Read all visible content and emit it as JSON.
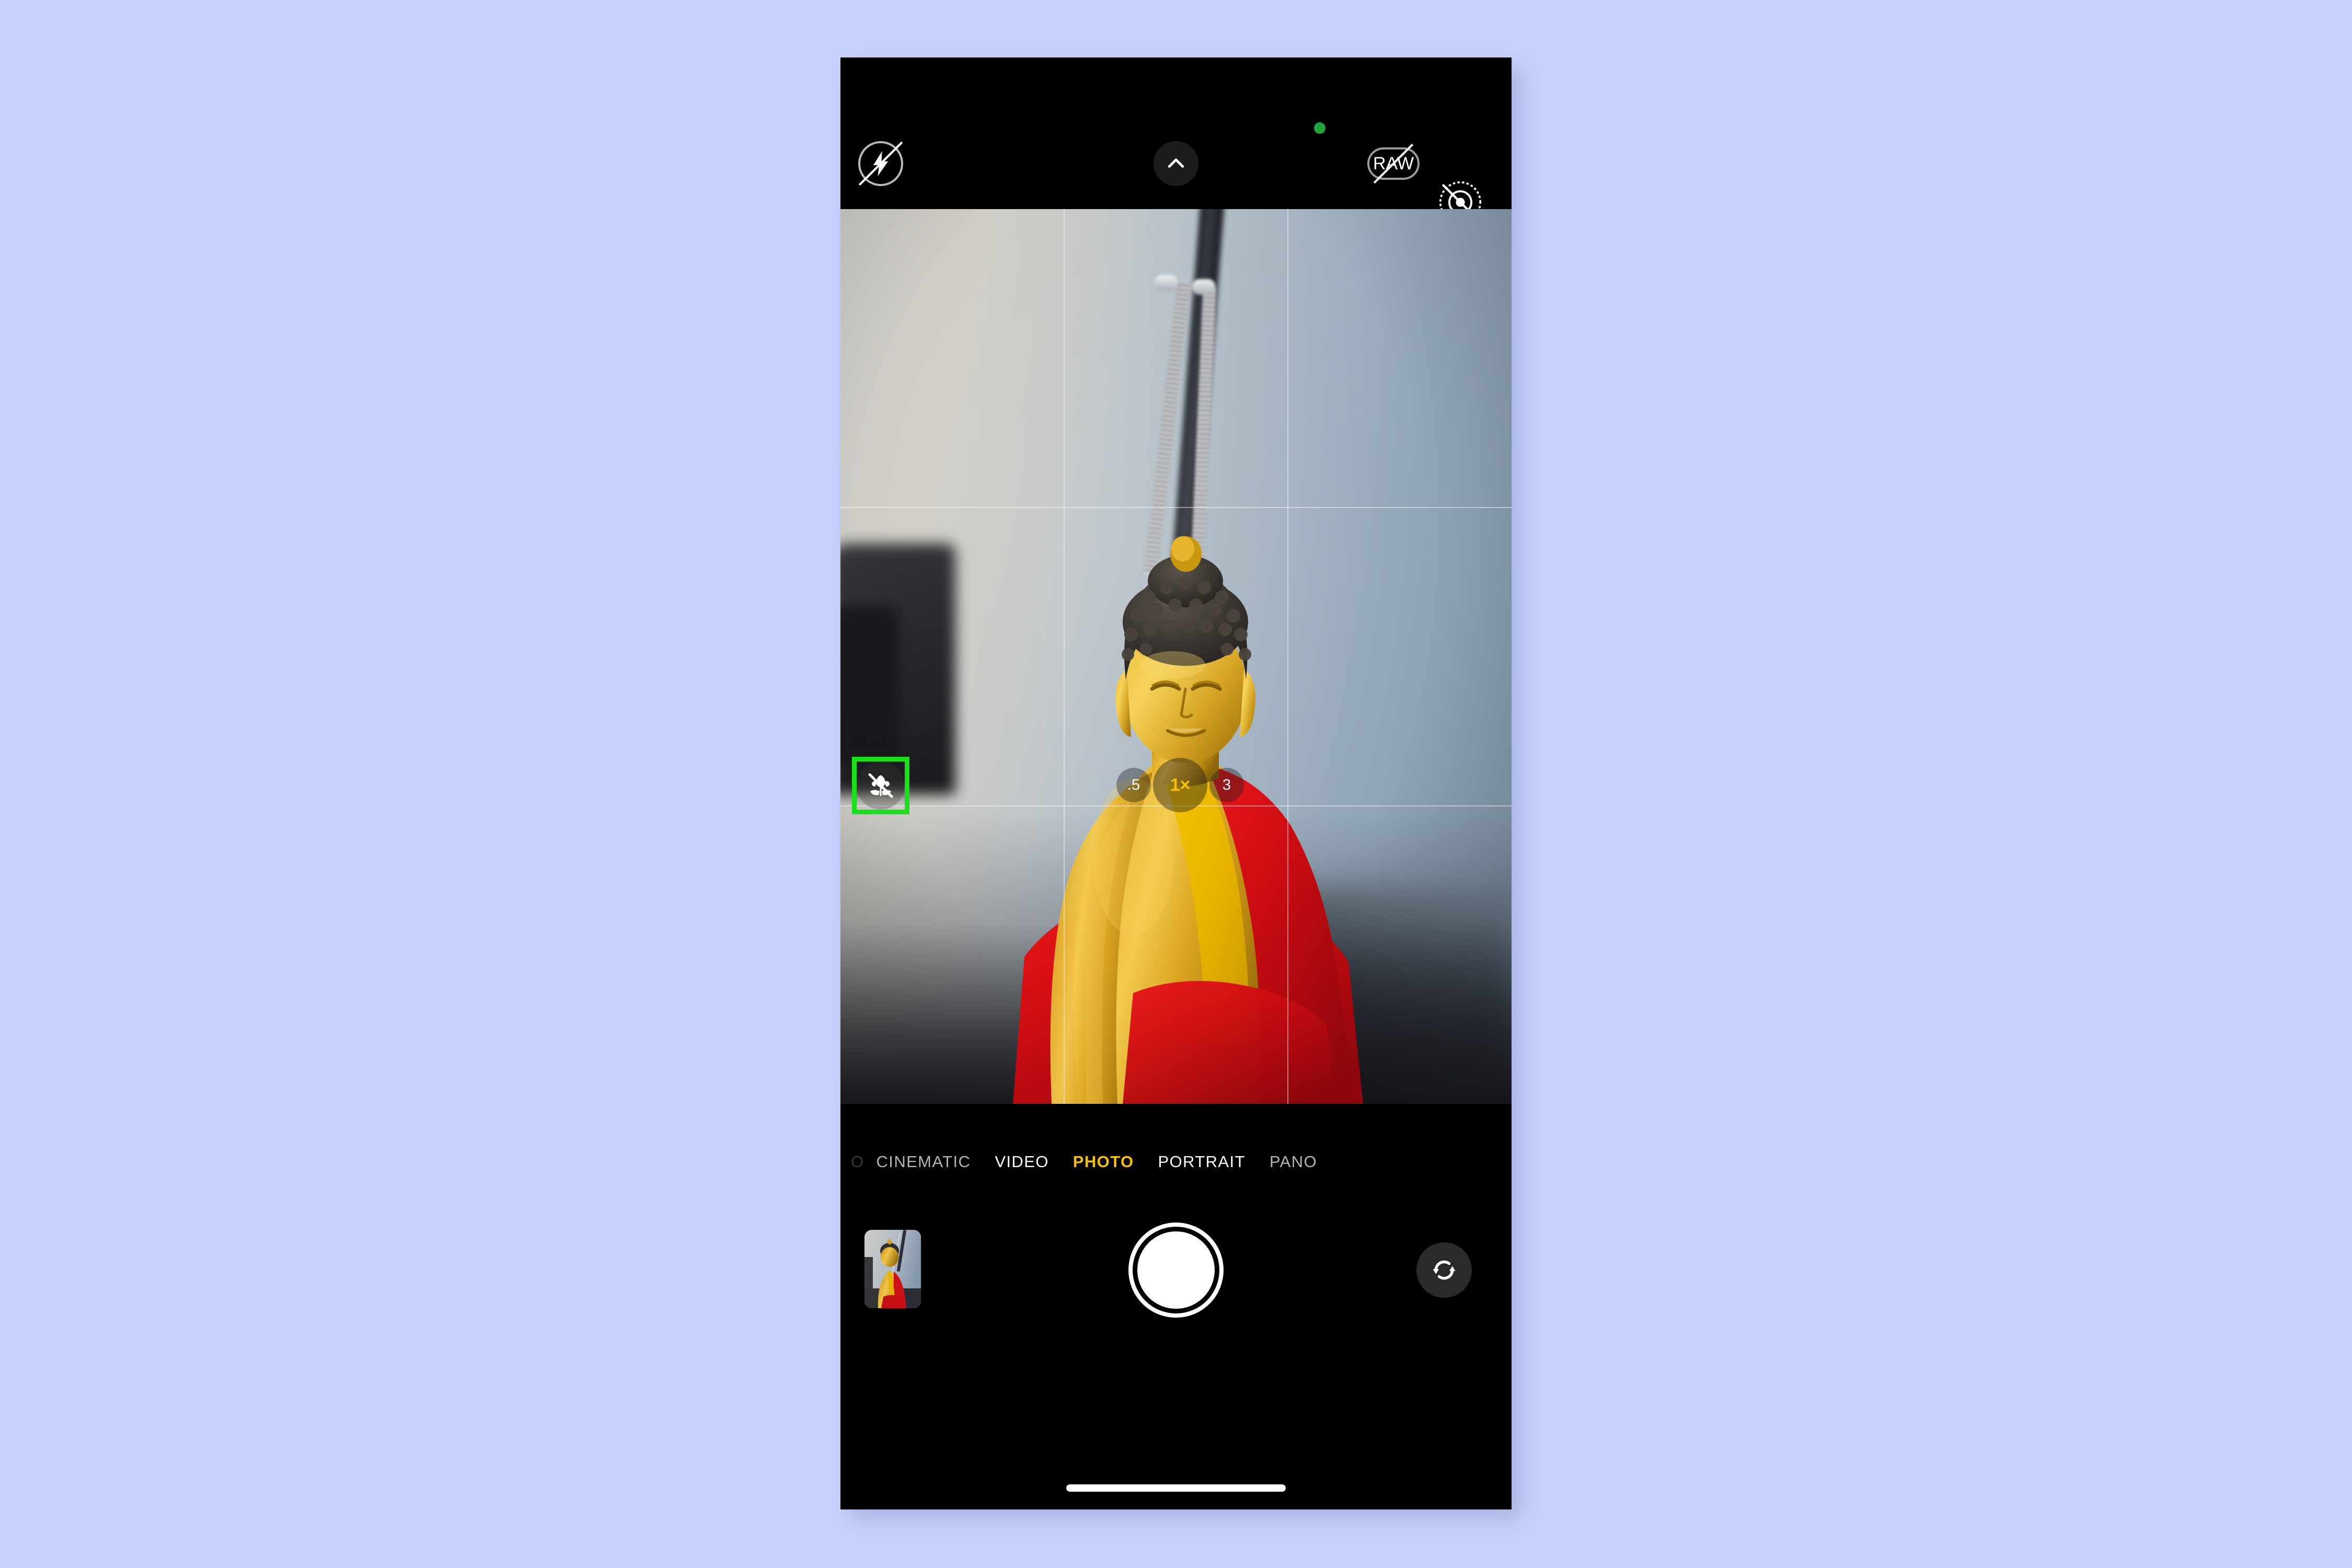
{
  "app": {
    "name": "Camera",
    "platform": "iOS",
    "background_color": "#c7d3fc",
    "screen_background": "#000000"
  },
  "status": {
    "privacy_indicator": "camera-in-use",
    "privacy_indicator_color": "#1fa33b"
  },
  "top_controls": {
    "flash": {
      "name": "flash-off",
      "label": "Flash Off",
      "state": "off"
    },
    "expand": {
      "name": "more-controls",
      "label": "More Controls",
      "glyph": "chevron-up"
    },
    "raw": {
      "name": "raw-off",
      "label": "RAW",
      "text": "RAW",
      "state": "off"
    },
    "live_photo": {
      "name": "live-photo-off",
      "label": "Live Photo Off",
      "state": "off"
    }
  },
  "preview": {
    "grid_enabled": true,
    "subject": "golden Buddha statue in red and yellow robe",
    "background": "blurred blue-gray wall with desk lamp"
  },
  "macro": {
    "label": "Macro Control Off",
    "state": "off",
    "highlighted": true,
    "highlight_color": "#19e019"
  },
  "zoom": {
    "options": [
      {
        "label": ".5",
        "value": "0.5",
        "active": false
      },
      {
        "label": "1×",
        "value": "1",
        "active": true
      },
      {
        "label": "3",
        "value": "3",
        "active": false
      }
    ],
    "active_label": "1×",
    "active_color": "#f5c100"
  },
  "modes": {
    "items": [
      {
        "label": "O",
        "partial": true,
        "active": false
      },
      {
        "label": "CINEMATIC",
        "partial": false,
        "active": false
      },
      {
        "label": "VIDEO",
        "partial": false,
        "active": false
      },
      {
        "label": "PHOTO",
        "partial": false,
        "active": true
      },
      {
        "label": "PORTRAIT",
        "partial": false,
        "active": false
      },
      {
        "label": "PANO",
        "partial": false,
        "active": false
      }
    ],
    "active": "PHOTO",
    "active_color": "#f5c100"
  },
  "bottom_controls": {
    "thumbnail": {
      "name": "last-photo-thumbnail",
      "label": "Photo Library"
    },
    "shutter": {
      "name": "shutter-button",
      "label": "Take Photo"
    },
    "flip": {
      "name": "camera-flip-button",
      "label": "Switch Camera"
    }
  },
  "home_indicator": {
    "label": "Home Indicator"
  }
}
